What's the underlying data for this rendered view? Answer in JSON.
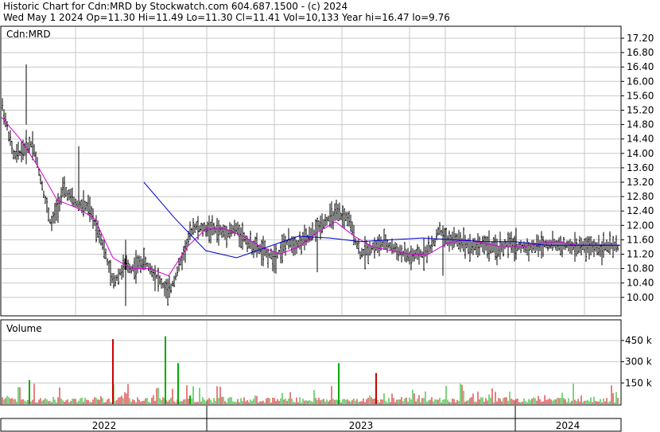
{
  "header": {
    "line1": "Historic Chart for Cdn:MRD by Stockwatch.com 604.687.1500 - (c) 2024",
    "line2": "Wed May  1 2024   Op=11.30   Hi=11.49   Lo=11.30   Cl=11.41   Vol=10,133   Year hi=16.47   lo=9.76"
  },
  "chart_data": [
    {
      "type": "ohlc",
      "title": "Cdn:MRD",
      "ylim": [
        9.76,
        17.4
      ],
      "ytick_labels": [
        "17.20",
        "16.80",
        "16.40",
        "16.00",
        "15.60",
        "15.20",
        "14.80",
        "14.40",
        "14.00",
        "13.60",
        "13.20",
        "12.80",
        "12.40",
        "12.00",
        "11.60",
        "11.20",
        "10.80",
        "10.40",
        "10.00"
      ],
      "x_labels": [
        "2022",
        "2023",
        "2024"
      ],
      "grid": true,
      "price_path_x": [
        0,
        0.02,
        0.05,
        0.08,
        0.1,
        0.12,
        0.14,
        0.16,
        0.18,
        0.2,
        0.21,
        0.23,
        0.25,
        0.27,
        0.29,
        0.31,
        0.32,
        0.33,
        0.34,
        0.36,
        0.38,
        0.4,
        0.42,
        0.44,
        0.46,
        0.48,
        0.5,
        0.52,
        0.54,
        0.56,
        0.58,
        0.6,
        0.62,
        0.64,
        0.66,
        0.68,
        0.7,
        0.705,
        0.72,
        0.74,
        0.76,
        0.78,
        0.8,
        0.82,
        0.84,
        0.86,
        0.88,
        0.9,
        0.92,
        0.94,
        0.96,
        0.98,
        1.0
      ],
      "price_path_y": [
        15.4,
        13.9,
        14.3,
        12.0,
        13.0,
        12.6,
        12.5,
        11.7,
        10.4,
        10.9,
        10.8,
        11.0,
        10.6,
        10.1,
        11.0,
        12.0,
        11.9,
        11.9,
        11.9,
        11.8,
        11.9,
        11.5,
        11.3,
        11.1,
        11.5,
        11.5,
        11.7,
        12.1,
        12.3,
        12.2,
        11.2,
        11.4,
        11.5,
        11.3,
        11.1,
        11.2,
        11.5,
        11.9,
        11.6,
        11.6,
        11.4,
        11.5,
        11.3,
        11.5,
        11.4,
        11.4,
        11.5,
        11.45,
        11.4,
        11.4,
        11.4,
        11.4,
        11.4
      ],
      "ma_fast_x": [
        0,
        0.03,
        0.06,
        0.09,
        0.12,
        0.15,
        0.18,
        0.21,
        0.24,
        0.27,
        0.3,
        0.33,
        0.36,
        0.39,
        0.42,
        0.45,
        0.48,
        0.51,
        0.54,
        0.57,
        0.6,
        0.63,
        0.66,
        0.69,
        0.72,
        0.75,
        0.78,
        0.81,
        0.84,
        0.87,
        0.9,
        0.93,
        0.96,
        1.0
      ],
      "ma_fast_y": [
        15.0,
        14.4,
        13.6,
        12.7,
        12.5,
        12.2,
        11.1,
        10.8,
        10.8,
        10.6,
        11.4,
        11.9,
        11.9,
        11.7,
        11.4,
        11.2,
        11.4,
        11.8,
        12.1,
        11.7,
        11.4,
        11.3,
        11.2,
        11.2,
        11.5,
        11.6,
        11.5,
        11.4,
        11.4,
        11.5,
        11.55,
        11.45,
        11.45,
        11.45
      ],
      "ma_slow_x": [
        0.23,
        0.28,
        0.33,
        0.38,
        0.43,
        0.48,
        0.53,
        0.58,
        0.63,
        0.68,
        0.73,
        0.78,
        0.83,
        0.88,
        0.93,
        0.98,
        1.0
      ],
      "ma_slow_y": [
        13.2,
        12.2,
        11.3,
        11.1,
        11.4,
        11.7,
        11.65,
        11.55,
        11.6,
        11.65,
        11.6,
        11.55,
        11.55,
        11.45,
        11.45,
        11.45,
        11.45
      ],
      "colors": {
        "ma_fast": "#d400d4",
        "ma_slow": "#0000cc",
        "bar": "#000000",
        "grid": "#c8c8c8"
      }
    },
    {
      "type": "bar",
      "title": "Volume",
      "ytick_labels": [
        "450 k",
        "300 k",
        "150 k"
      ],
      "spikes": [
        {
          "x": 0.045,
          "value": 170,
          "color": "green"
        },
        {
          "x": 0.18,
          "value": 460,
          "color": "red"
        },
        {
          "x": 0.265,
          "value": 480,
          "color": "green"
        },
        {
          "x": 0.285,
          "value": 290,
          "color": "green"
        },
        {
          "x": 0.305,
          "value": 60,
          "color": "green"
        },
        {
          "x": 0.545,
          "value": 290,
          "color": "green"
        },
        {
          "x": 0.605,
          "value": 220,
          "color": "red"
        }
      ],
      "colors": {
        "up": "#00aa00",
        "down": "#cc0000"
      }
    }
  ]
}
